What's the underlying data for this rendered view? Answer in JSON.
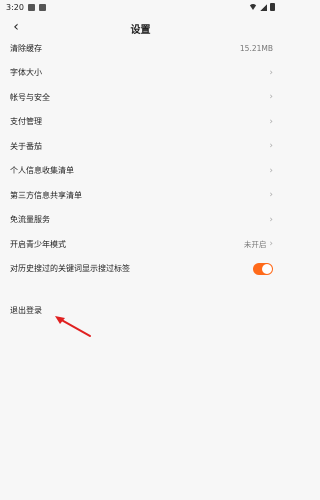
{
  "status": {
    "time": "3:20"
  },
  "nav": {
    "title": "设置"
  },
  "items": [
    {
      "label": "清除缓存",
      "value": "15.21MB",
      "type": "value"
    },
    {
      "label": "字体大小",
      "type": "chevron"
    },
    {
      "label": "帐号与安全",
      "type": "chevron"
    },
    {
      "label": "支付管理",
      "type": "chevron"
    },
    {
      "label": "关于番茄",
      "type": "chevron"
    },
    {
      "label": "个人信息收集清单",
      "type": "chevron"
    },
    {
      "label": "第三方信息共享清单",
      "type": "chevron"
    },
    {
      "label": "免流量服务",
      "type": "chevron"
    },
    {
      "label": "开启青少年模式",
      "value": "未开启",
      "type": "value-chevron"
    },
    {
      "label": "对历史搜过的关键词显示搜过标签",
      "type": "toggle",
      "toggle_on": true
    }
  ],
  "logout": {
    "label": "退出登录"
  },
  "colors": {
    "accent": "#ff6a1a",
    "annotation": "#e02020"
  }
}
